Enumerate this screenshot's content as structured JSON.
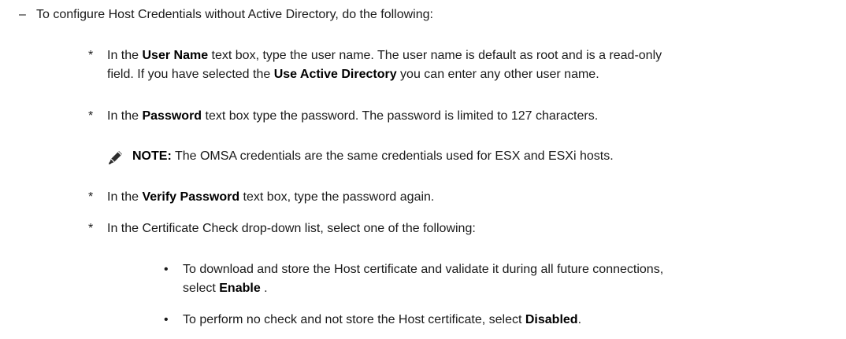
{
  "intro": {
    "dash": "–",
    "text": "To configure Host Credentials without Active Directory, do the following:"
  },
  "steps": [
    {
      "marker": "*",
      "line1": {
        "a": "In the ",
        "b": "User Name",
        "c": " text box, type the user name. The user name is default as root and is a read-only"
      },
      "line2": {
        "a": "field. If you have selected the ",
        "b": "Use Active Directory",
        "c": " you can enter any other user name."
      }
    },
    {
      "marker": "*",
      "line1": {
        "a": "In the ",
        "b": "Password",
        "c": " text box type the password. The password is limited to 127 characters."
      }
    },
    {
      "marker": "*",
      "line1": {
        "a": "In the ",
        "b": "Verify Password",
        "c": " text box, type the password again."
      }
    },
    {
      "marker": "*",
      "line1": {
        "a": "In the Certificate Check drop-down list, select one of the following:"
      }
    }
  ],
  "note": {
    "icon": "pencil-note-icon",
    "label": "NOTE:",
    "text": " The OMSA credentials are the same credentials used for ESX and ESXi hosts."
  },
  "options": [
    {
      "bullet": "•",
      "line1": "To download and store the Host certificate and validate it during all future connections,",
      "line2_a": "select ",
      "line2_b": "Enable",
      "line2_c": " ."
    },
    {
      "bullet": "•",
      "line1_a": "To perform no check and not store the Host certificate, select ",
      "line1_b": "Disabled",
      "line1_c": "."
    }
  ]
}
